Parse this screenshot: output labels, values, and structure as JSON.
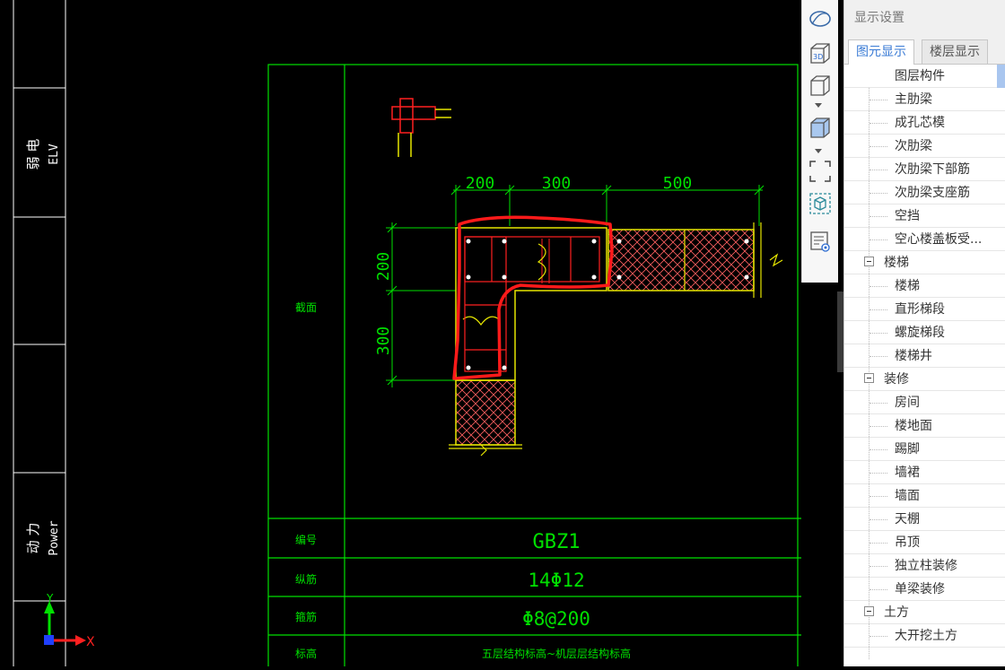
{
  "cad": {
    "left_panel": {
      "elv_cn": "弱 电",
      "elv_en": "ELV",
      "power_cn": "动 力",
      "power_en": "Power"
    },
    "axis": {
      "x": "X",
      "y": "Y"
    },
    "dimensions": {
      "top": [
        "200",
        "300",
        "500"
      ],
      "left": [
        "200",
        "300"
      ]
    },
    "table": {
      "section_label": "截面",
      "rows": [
        {
          "label": "编号",
          "value": "GBZ1"
        },
        {
          "label": "纵筋",
          "value": "14Φ12"
        },
        {
          "label": "箍筋",
          "value": "Φ8@200"
        },
        {
          "label": "标高",
          "value": "五层结构标高~机层层结构标高"
        }
      ]
    },
    "colors": {
      "line": "#00ff00",
      "wall": "#e6e600",
      "rebar": "#ff0000",
      "highlight": "#ff1a1a"
    }
  },
  "toolbar": {
    "buttons": [
      "orbit-icon",
      "view-3d-icon",
      "cube-view-icon",
      "solid-cube-icon",
      "marquee-icon",
      "component-icon",
      "display-settings-icon"
    ],
    "label_3d": "3D"
  },
  "panel": {
    "title": "显示设置",
    "tabs": [
      {
        "label": "图元显示",
        "active": true
      },
      {
        "label": "楼层显示",
        "active": false
      }
    ],
    "tree": [
      {
        "label": "图层构件",
        "type": "header"
      },
      {
        "label": "主肋梁",
        "type": "leaf"
      },
      {
        "label": "成孔芯模",
        "type": "leaf"
      },
      {
        "label": "次肋梁",
        "type": "leaf"
      },
      {
        "label": "次肋梁下部筋",
        "type": "leaf"
      },
      {
        "label": "次肋梁支座筋",
        "type": "leaf"
      },
      {
        "label": "空挡",
        "type": "leaf"
      },
      {
        "label": "空心楼盖板受...",
        "type": "leaf"
      },
      {
        "label": "楼梯",
        "type": "group"
      },
      {
        "label": "楼梯",
        "type": "leaf"
      },
      {
        "label": "直形梯段",
        "type": "leaf"
      },
      {
        "label": "螺旋梯段",
        "type": "leaf"
      },
      {
        "label": "楼梯井",
        "type": "leaf"
      },
      {
        "label": "装修",
        "type": "group"
      },
      {
        "label": "房间",
        "type": "leaf"
      },
      {
        "label": "楼地面",
        "type": "leaf"
      },
      {
        "label": "踢脚",
        "type": "leaf"
      },
      {
        "label": "墙裙",
        "type": "leaf"
      },
      {
        "label": "墙面",
        "type": "leaf"
      },
      {
        "label": "天棚",
        "type": "leaf"
      },
      {
        "label": "吊顶",
        "type": "leaf"
      },
      {
        "label": "独立柱装修",
        "type": "leaf"
      },
      {
        "label": "单梁装修",
        "type": "leaf"
      },
      {
        "label": "土方",
        "type": "group"
      },
      {
        "label": "大开挖土方",
        "type": "leaf"
      }
    ]
  }
}
